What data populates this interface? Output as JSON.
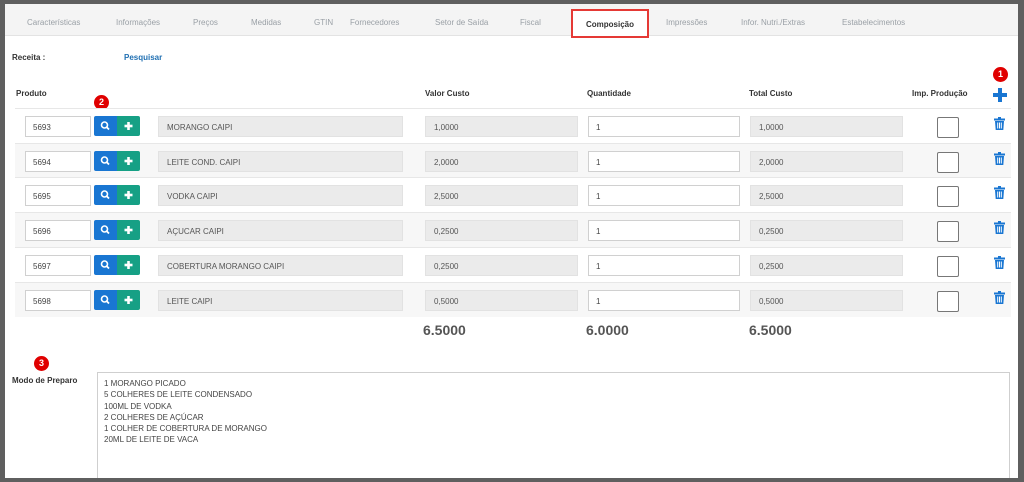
{
  "tabs": [
    {
      "label": "Características"
    },
    {
      "label": "Informações"
    },
    {
      "label": "Preços"
    },
    {
      "label": "Medidas"
    },
    {
      "label": "GTIN"
    },
    {
      "label": "Fornecedores"
    },
    {
      "label": "Setor de Saída"
    },
    {
      "label": "Fiscal"
    },
    {
      "label": "Composição",
      "active": true
    },
    {
      "label": "Impressões"
    },
    {
      "label": "Infor. Nutri./Extras"
    },
    {
      "label": "Estabelecimentos"
    }
  ],
  "receita": {
    "label": "Receita :",
    "link": "Pesquisar"
  },
  "columns": {
    "produto": "Produto",
    "valor_custo": "Valor Custo",
    "quantidade": "Quantidade",
    "total_custo": "Total Custo",
    "imp_producao": "Imp. Produção"
  },
  "rows": [
    {
      "code": "5693",
      "name": "MORANGO CAIPI",
      "valor": "1,0000",
      "qtd": "1",
      "total": "1,0000"
    },
    {
      "code": "5694",
      "name": "LEITE COND. CAIPI",
      "valor": "2,0000",
      "qtd": "1",
      "total": "2,0000"
    },
    {
      "code": "5695",
      "name": "VODKA CAIPI",
      "valor": "2,5000",
      "qtd": "1",
      "total": "2,5000"
    },
    {
      "code": "5696",
      "name": "AÇUCAR CAIPI",
      "valor": "0,2500",
      "qtd": "1",
      "total": "0,2500"
    },
    {
      "code": "5697",
      "name": "COBERTURA MORANGO CAIPI",
      "valor": "0,2500",
      "qtd": "1",
      "total": "0,2500"
    },
    {
      "code": "5698",
      "name": "LEITE CAIPI",
      "valor": "0,5000",
      "qtd": "1",
      "total": "0,5000"
    }
  ],
  "totals": {
    "valor_custo": "6.5000",
    "quantidade": "6.0000",
    "total_custo": "6.5000"
  },
  "modo_preparo": {
    "label": "Modo de Preparo",
    "lines": [
      "1 MORANGO PICADO",
      "5 COLHERES DE LEITE CONDENSADO",
      "100ML DE VODKA",
      "2 COLHERES DE AÇÚCAR",
      "1 COLHER DE COBERTURA DE MORANGO",
      "20ML DE LEITE DE VACA"
    ]
  },
  "badges": {
    "one": "1",
    "two": "2",
    "three": "3"
  },
  "colors": {
    "accent": "#1976d2",
    "add_green": "#16a085",
    "highlight_red": "#e53935",
    "badge_red": "#e00000"
  }
}
